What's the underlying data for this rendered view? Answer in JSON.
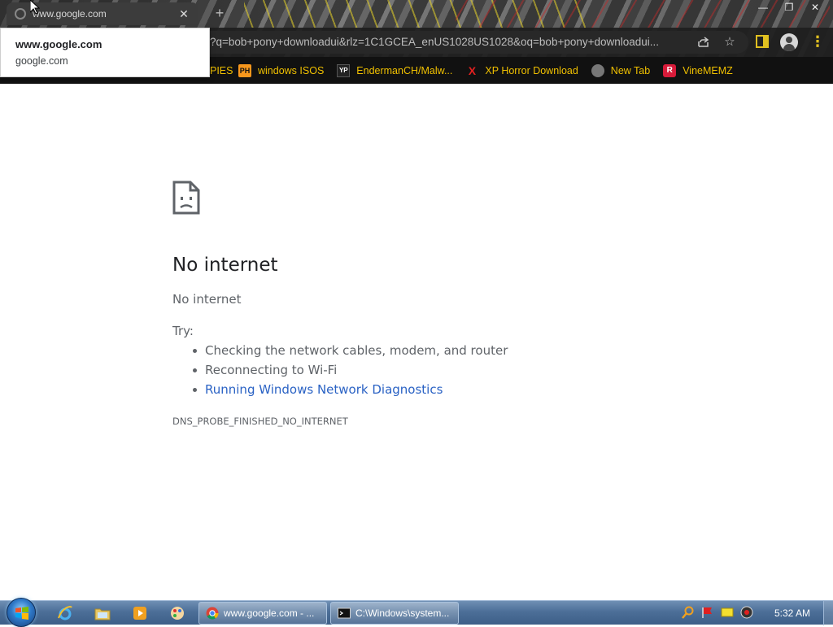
{
  "browser": {
    "tab_title": "www.google.com",
    "address": "?q=bob+pony+downloadui&rlz=1C1GCEA_enUS1028US1028&oq=bob+pony+downloadui...",
    "hover_card": {
      "title": "www.google.com",
      "domain": "google.com"
    },
    "bookmark_partial": "PIES",
    "bookmarks": [
      {
        "label": "windows ISOS",
        "icon": "ph-icon",
        "icon_text": "PH"
      },
      {
        "label": "EndermanCH/Malw...",
        "icon": "yp-icon",
        "icon_text": "YP"
      },
      {
        "label": "XP Horror Download",
        "icon": "x-icon",
        "icon_text": "X"
      },
      {
        "label": "New Tab",
        "icon": "globe-icon",
        "icon_text": ""
      },
      {
        "label": "VineMEMZ",
        "icon": "r-icon",
        "icon_text": "R"
      }
    ]
  },
  "error": {
    "title": "No internet",
    "subtitle": "No internet",
    "try_label": "Try:",
    "suggestions": [
      "Checking the network cables, modem, and router",
      "Reconnecting to Wi-Fi",
      "Running Windows Network Diagnostics"
    ],
    "code": "DNS_PROBE_FINISHED_NO_INTERNET"
  },
  "taskbar": {
    "tasks": [
      {
        "label": "www.google.com - ..."
      },
      {
        "label": "C:\\Windows\\system..."
      }
    ],
    "clock": "5:32 AM"
  },
  "colors": {
    "bookmark_text": "#f0c000",
    "link": "#2a62c4",
    "accent": "#e0c020"
  }
}
